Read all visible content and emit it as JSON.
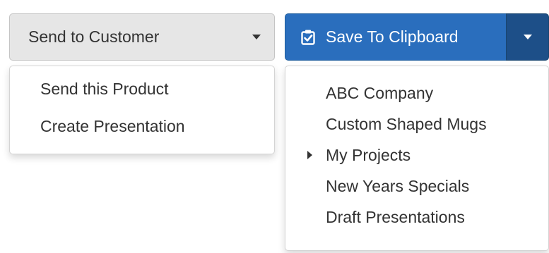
{
  "send_dropdown": {
    "label": "Send to Customer",
    "icon": "caret-down-icon",
    "menu_items": [
      {
        "label": "Send this Product"
      },
      {
        "label": "Create Presentation"
      }
    ]
  },
  "save_dropdown": {
    "label": "Save To Clipboard",
    "icon": "clipboard-check-icon",
    "toggle_icon": "caret-down-icon",
    "menu_items": [
      {
        "label": "ABC Company"
      },
      {
        "label": "Custom Shaped Mugs"
      },
      {
        "label": "My Projects",
        "has_submenu": true
      },
      {
        "label": "New Years Specials"
      },
      {
        "label": "Draft Presentations"
      }
    ]
  },
  "colors": {
    "primary_button": "#2a6ebd",
    "primary_toggle": "#1d4f88",
    "default_button": "#e6e6e6",
    "text": "#333333"
  }
}
